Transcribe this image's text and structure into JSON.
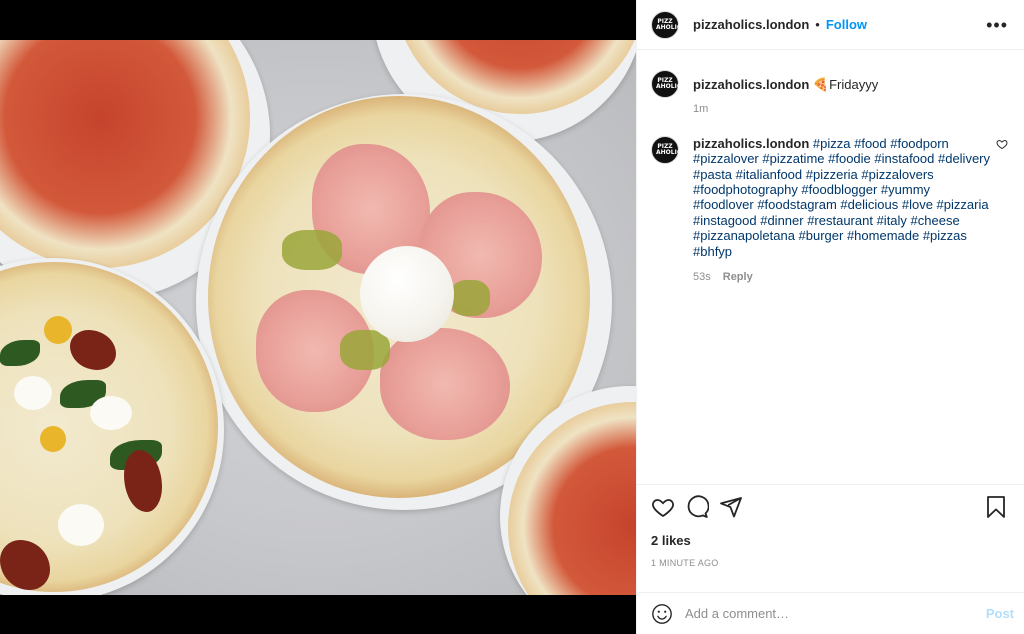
{
  "post": {
    "username": "pizzaholics.london",
    "separator": "•",
    "follow_label": "Follow",
    "more_label": "•••",
    "avatar_text": "PIZZ AHOLICS"
  },
  "comments": [
    {
      "username": "pizzaholics.london",
      "text": "🍕Fridayyy",
      "time": "1m"
    },
    {
      "username": "pizzaholics.london",
      "text": "#pizza #food #foodporn #pizzalover #pizzatime #foodie #instafood #delivery #pasta #italianfood #pizzeria #pizzalovers #foodphotography #foodblogger #yummy #foodlover #foodstagram #delicious #love #pizzaria #instagood #dinner #restaurant #italy #cheese #pizzanapoletana #burger #homemade #pizzas #bhfyp",
      "time": "53s",
      "reply_label": "Reply"
    }
  ],
  "actions": {
    "likes": "2 likes",
    "timestamp": "1 minute ago"
  },
  "add_comment": {
    "placeholder": "Add a comment…",
    "post_label": "Post"
  },
  "colors": {
    "follow": "#0095f6",
    "hashtag": "#00376b",
    "post_disabled": "#b2dffc",
    "meta": "#8e8e8e"
  },
  "icons": [
    "heart-icon",
    "comment-icon",
    "share-icon",
    "bookmark-icon",
    "emoji-icon",
    "more-options-icon"
  ]
}
